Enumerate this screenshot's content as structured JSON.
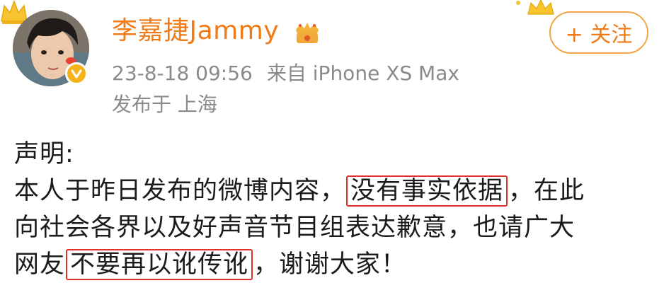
{
  "user": {
    "name": "李嘉捷Jammy",
    "verified": true
  },
  "post_meta": {
    "time": "23-8-18 09:56",
    "source": "来自 iPhone XS Max",
    "location": "发布于 上海"
  },
  "follow_button": {
    "label": "+ 关注"
  },
  "post": {
    "heading": "声明:",
    "line1_a": "本人于昨日发布的微博内容，",
    "line1_hl": "没有事实依据",
    "line1_b": "，在此",
    "line2": "向社会各界以及好声音节目组表达歉意，也请广大",
    "line3_a": "网友",
    "line3_hl": "不要再以讹传讹",
    "line3_b": "，谢谢大家！"
  },
  "colors": {
    "accent_orange": "#f07a16",
    "meta_gray": "#8a8a8a",
    "highlight_red": "#e0322a",
    "verify_gold": "#f5b31a"
  }
}
